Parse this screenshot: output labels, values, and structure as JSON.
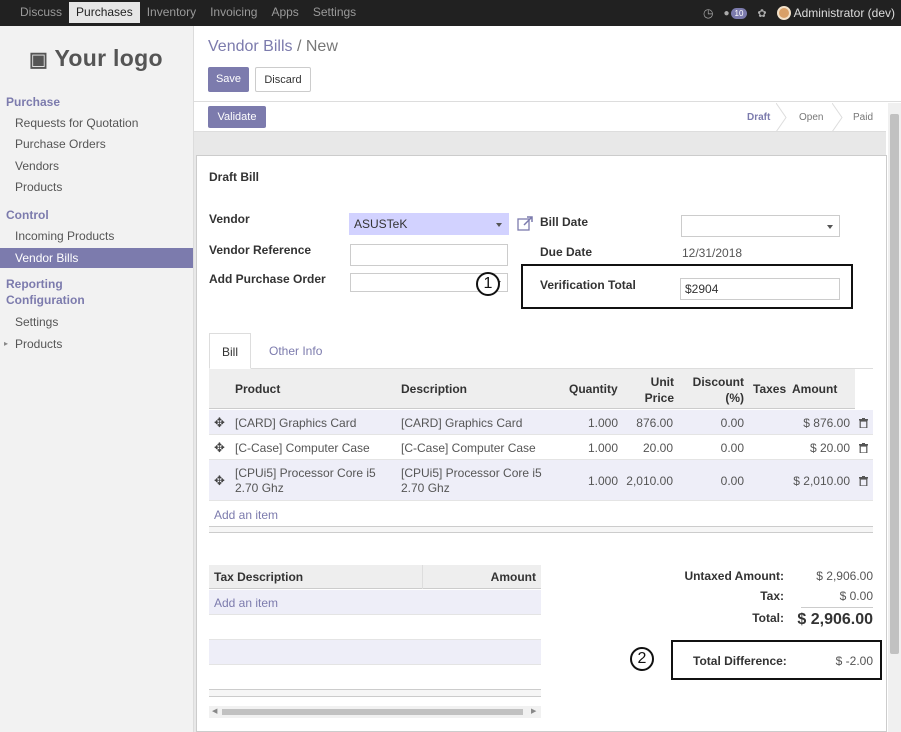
{
  "topbar": {
    "menu": [
      "Discuss",
      "Purchases",
      "Inventory",
      "Invoicing",
      "Apps",
      "Settings"
    ],
    "active_index": 1,
    "notification_count": "10",
    "user": "Administrator (dev)"
  },
  "sidebar": {
    "logo": "Your logo",
    "sections": [
      {
        "title": "Purchase",
        "items": [
          "Requests for Quotation",
          "Purchase Orders",
          "Vendors",
          "Products"
        ]
      },
      {
        "title": "Control",
        "items": [
          "Incoming Products",
          "Vendor Bills"
        ]
      },
      {
        "title": "Reporting",
        "items": []
      },
      {
        "title": "Configuration",
        "items": [
          "Settings",
          "Products"
        ]
      }
    ]
  },
  "header": {
    "breadcrumb_parent": "Vendor Bills",
    "breadcrumb_sep": "/",
    "breadcrumb_current": "New",
    "save": "Save",
    "discard": "Discard"
  },
  "statusbar": {
    "validate": "Validate",
    "states": [
      "Draft",
      "Open",
      "Paid"
    ],
    "current": "Draft"
  },
  "form": {
    "title": "Draft Bill",
    "vendor_label": "Vendor",
    "vendor_value": "ASUSTeK",
    "vendor_ref_label": "Vendor Reference",
    "add_po_label": "Add Purchase Order",
    "bill_date_label": "Bill Date",
    "due_date_label": "Due Date",
    "due_date_value": "12/31/2018",
    "verification_label": "Verification Total",
    "verification_value": "$2904",
    "annotation_1": "1",
    "annotation_2": "2"
  },
  "tabs": [
    "Bill",
    "Other Info"
  ],
  "lines": {
    "headers": [
      "Product",
      "Description",
      "Quantity",
      "Unit Price",
      "Discount (%)",
      "Taxes",
      "Amount"
    ],
    "rows": [
      {
        "product": "[CARD] Graphics Card",
        "description": "[CARD] Graphics Card",
        "quantity": "1.000",
        "unit_price": "876.00",
        "discount": "0.00",
        "taxes": "",
        "amount": "$ 876.00"
      },
      {
        "product": "[C-Case] Computer Case",
        "description": "[C-Case] Computer Case",
        "quantity": "1.000",
        "unit_price": "20.00",
        "discount": "0.00",
        "taxes": "",
        "amount": "$ 20.00"
      },
      {
        "product": "[CPUi5] Processor Core i5 2.70 Ghz",
        "description": "[CPUi5] Processor Core i5 2.70 Ghz",
        "quantity": "1.000",
        "unit_price": "2,010.00",
        "discount": "0.00",
        "taxes": "",
        "amount": "$ 2,010.00"
      }
    ],
    "add_item": "Add an item"
  },
  "tax_table": {
    "headers": [
      "Tax Description",
      "Amount"
    ],
    "add_item": "Add an item"
  },
  "totals": {
    "untaxed_label": "Untaxed Amount:",
    "untaxed_value": "$ 2,906.00",
    "tax_label": "Tax:",
    "tax_value": "$ 0.00",
    "total_label": "Total:",
    "total_value": "$ 2,906.00",
    "difference_label": "Total Difference:",
    "difference_value": "$ -2.00"
  },
  "colors": {
    "primary": "#7c7bad",
    "topbar": "#212121",
    "required_field": "#d2d2ff"
  }
}
